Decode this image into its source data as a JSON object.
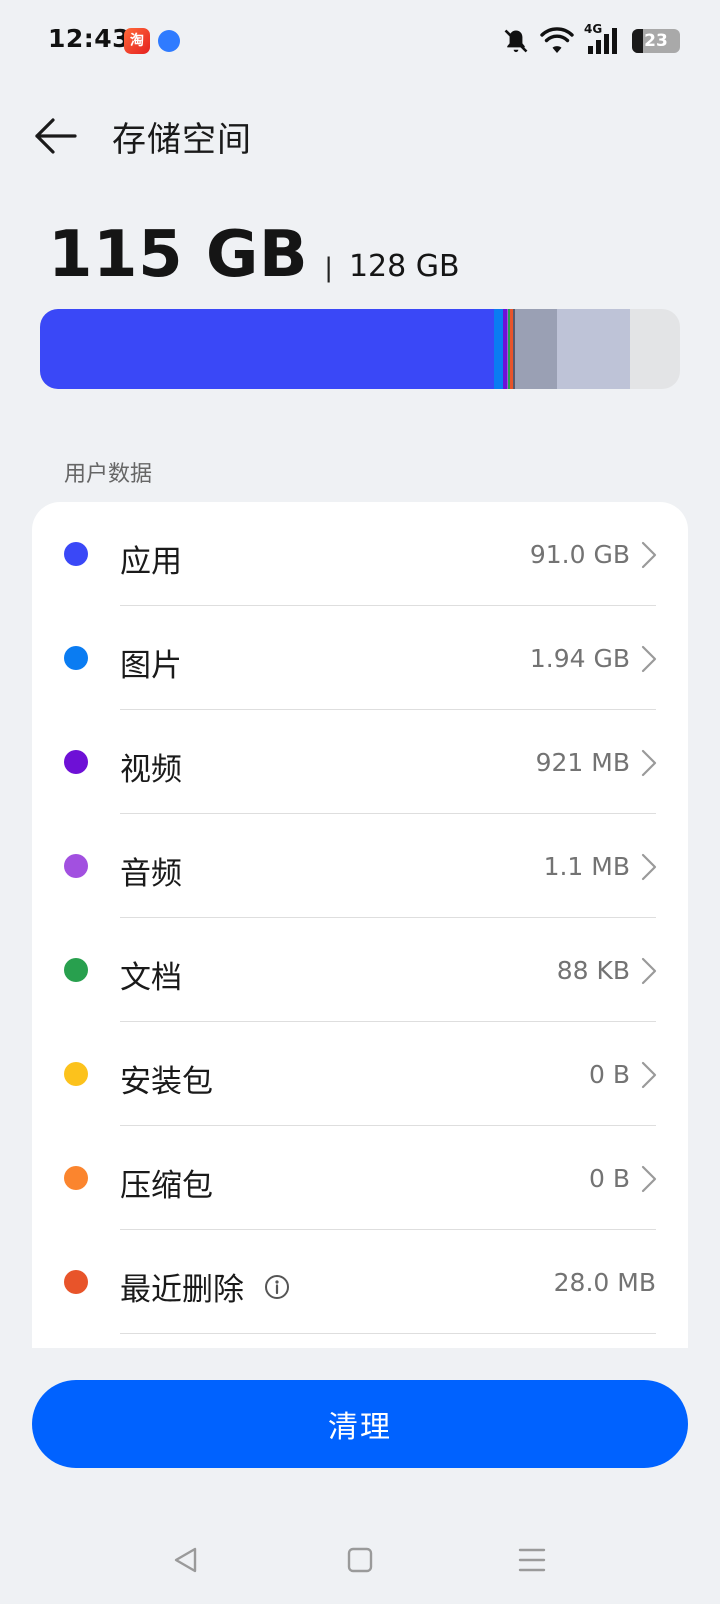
{
  "status_bar": {
    "time": "12:43",
    "taobao_badge_text": "淘",
    "network_label": "4G",
    "battery_level": "23",
    "battery_fraction": 0.23
  },
  "header": {
    "title": "存储空间"
  },
  "summary": {
    "used": "115 GB",
    "separator": "|",
    "total": "128 GB"
  },
  "usage_bar": [
    {
      "name": "apps",
      "fraction": 0.709,
      "color": "#3a48f7"
    },
    {
      "name": "images",
      "fraction": 0.015,
      "color": "#0a7cf2"
    },
    {
      "name": "videos",
      "fraction": 0.006,
      "color": "#6e10d6"
    },
    {
      "name": "audio",
      "fraction": 0.002,
      "color": "#a250e0"
    },
    {
      "name": "docs",
      "fraction": 0.003,
      "color": "#28a04e"
    },
    {
      "name": "recent-deleted",
      "fraction": 0.004,
      "color": "#e8542a"
    },
    {
      "name": "misc",
      "fraction": 0.004,
      "color": "#555a6e"
    },
    {
      "name": "system",
      "fraction": 0.065,
      "color": "#9aa0b4"
    },
    {
      "name": "other",
      "fraction": 0.114,
      "color": "#bec3d7"
    }
  ],
  "section": {
    "label": "用户数据"
  },
  "items": [
    {
      "label": "应用",
      "value": "91.0 GB",
      "color": "#3a48f7",
      "chevron": true
    },
    {
      "label": "图片",
      "value": "1.94 GB",
      "color": "#0a7cf2",
      "chevron": true
    },
    {
      "label": "视频",
      "value": "921 MB",
      "color": "#6e10d6",
      "chevron": true
    },
    {
      "label": "音频",
      "value": "1.1 MB",
      "color": "#a250e0",
      "chevron": true
    },
    {
      "label": "文档",
      "value": "88 KB",
      "color": "#28a04e",
      "chevron": true
    },
    {
      "label": "安装包",
      "value": "0 B",
      "color": "#fcc21c",
      "chevron": true
    },
    {
      "label": "压缩包",
      "value": "0 B",
      "color": "#fb852e",
      "chevron": true
    },
    {
      "label": "最近删除",
      "value": "28.0 MB",
      "color": "#e8542a",
      "chevron": false,
      "info_icon": true
    }
  ],
  "actions": {
    "clean_label": "清理"
  },
  "colors": {
    "accent": "#0062ff",
    "background": "#eff1f4",
    "card": "#ffffff"
  }
}
